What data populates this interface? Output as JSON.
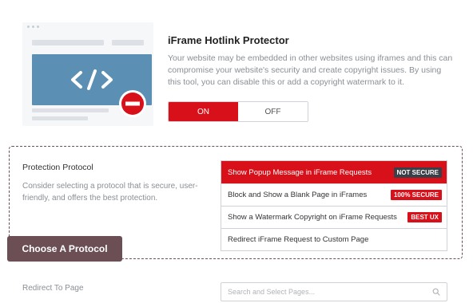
{
  "header": {
    "title": "iFrame Hotlink Protector",
    "description": "Your website may be embedded in other websites using iframes and this can compromise your website's security and create copyright issues. By using this tool, you can disable this or add a copyright watermark to it."
  },
  "toggle": {
    "on_label": "ON",
    "off_label": "OFF",
    "selected": "ON"
  },
  "protection": {
    "title": "Protection Protocol",
    "description": "Consider selecting a protocol that is secure, user-friendly, and offers the best protection.",
    "options": [
      {
        "label": "Show Popup Message in iFrame Requests",
        "badge": "NOT SECURE",
        "selected": true
      },
      {
        "label": "Block and Show a Blank Page in iFrames",
        "badge": "100% SECURE",
        "selected": false
      },
      {
        "label": "Show a Watermark Copyright on iFrame Requests",
        "badge": "BEST UX",
        "selected": false
      },
      {
        "label": "Redirect iFrame Request to Custom Page",
        "badge": "",
        "selected": false
      }
    ]
  },
  "callout": {
    "label": "Choose A Protocol"
  },
  "redirect": {
    "label": "Redirect To Page",
    "placeholder": "Search and Select Pages..."
  },
  "colors": {
    "accent": "#d8101a",
    "callout": "#6b4f55",
    "illustration": "#5b8fb3"
  },
  "icons": [
    "code-icon",
    "no-entry-icon",
    "search-icon"
  ]
}
